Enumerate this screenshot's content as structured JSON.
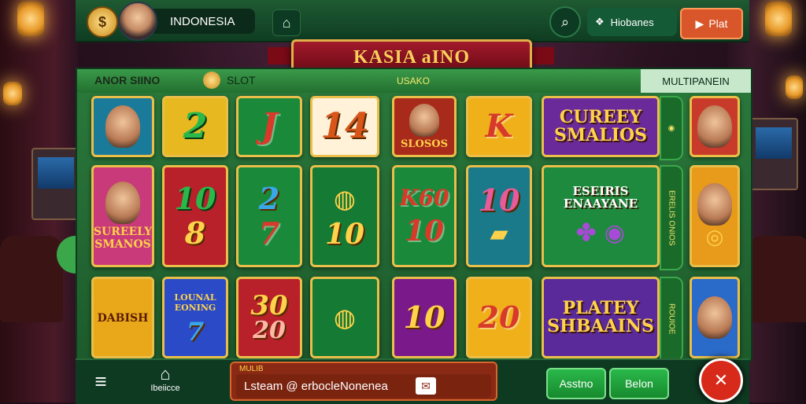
{
  "header": {
    "country": "INDONESIA",
    "search_icon": "search-icon",
    "bonus_label": "Hiobanes",
    "play_label": "Plat"
  },
  "banner": {
    "title": "KASIA aINO"
  },
  "subbar": {
    "logo": "ANOR SIINO",
    "slot": "SLOT",
    "center": "USAKO",
    "right": "MULTIPANEIN"
  },
  "tiles": {
    "t1_num": "2",
    "t2_num": "J",
    "t3_num": "14",
    "t4_caption": "SLOSOS",
    "t5_num": "K",
    "promo1": "CUREEY SMALIOS",
    "t7_caption": "SUREELY SMANOS",
    "t8_top": "10",
    "t8_bot": "8",
    "t9_top": "2",
    "t9_bot": "7",
    "t10_bot": "10",
    "t11_top": "K60",
    "t11_bot": "10",
    "t12_top": "10",
    "promo2": "ESEIRIS ENAAYANE",
    "side1": "ERELIS ONIOS",
    "t13_caption": "DABISH",
    "t14_caption": "LOUNAL EONING",
    "t15_top": "30",
    "t15_bot": "20",
    "t17_num": "10",
    "t18_num": "20",
    "promo3": "PLATEY SHBAAINS",
    "side2": "ROUIOE"
  },
  "footer": {
    "home_label": "Ibeiicce",
    "chat_title": "MULIB",
    "chat_value": "Lsteam @ erbocleNonenea",
    "btn1": "Asstno",
    "btn2": "Belon"
  }
}
